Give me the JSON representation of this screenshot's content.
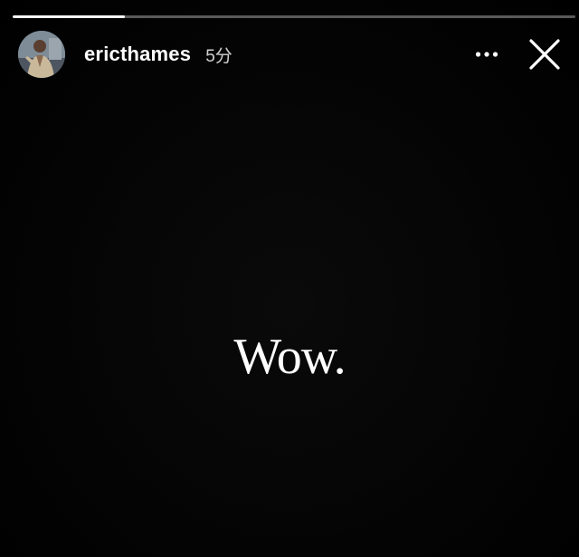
{
  "story": {
    "progress": 0.2,
    "user": {
      "username": "ericthames",
      "time_ago": "5分",
      "avatar": "profile-photo"
    },
    "caption": "Wow.",
    "icons": {
      "more": "more-horizontal-icon",
      "close": "close-icon"
    }
  }
}
